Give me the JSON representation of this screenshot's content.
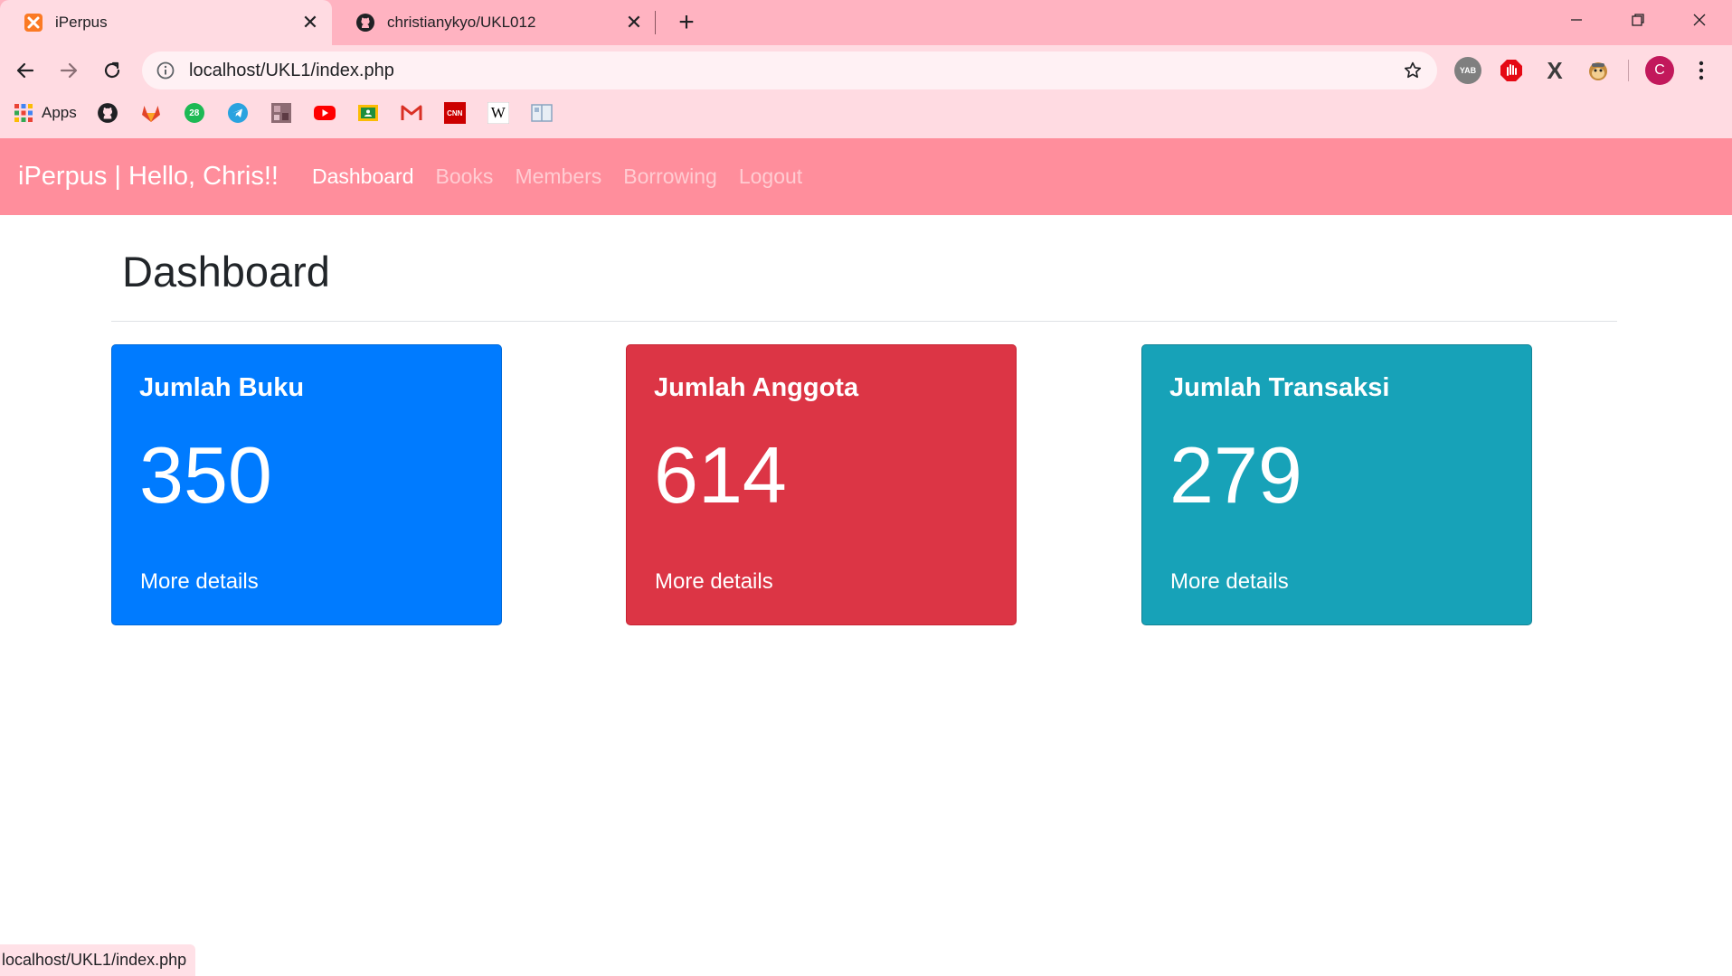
{
  "browser": {
    "tabs": [
      {
        "title": "iPerpus",
        "icon": "xampp-icon",
        "active": true
      },
      {
        "title": "christianykyo/UKL012",
        "icon": "github-icon",
        "active": false
      }
    ],
    "address": {
      "url": "localhost/UKL1/index.php"
    },
    "bookmarks": {
      "apps_label": "Apps",
      "items": [
        {
          "name": "github-icon"
        },
        {
          "name": "gitlab-icon"
        },
        {
          "name": "badge-28-icon",
          "text": "28"
        },
        {
          "name": "telegram-icon"
        },
        {
          "name": "photo-icon"
        },
        {
          "name": "youtube-icon"
        },
        {
          "name": "classroom-icon"
        },
        {
          "name": "gmail-icon"
        },
        {
          "name": "cnn-icon",
          "text": "CNN"
        },
        {
          "name": "wikipedia-icon",
          "text": "W"
        },
        {
          "name": "reader-icon"
        }
      ]
    },
    "extensions": [
      {
        "name": "yab-icon",
        "text": "YAB"
      },
      {
        "name": "stop-hand-icon"
      },
      {
        "name": "x-icon",
        "text": "X"
      },
      {
        "name": "monkey-icon"
      }
    ],
    "profile": {
      "initial": "C",
      "color": "#c2185b"
    },
    "status_url": "localhost/UKL1/index.php"
  },
  "site": {
    "brand": "iPerpus | Hello, Chris!!",
    "nav": [
      "Dashboard",
      "Books",
      "Members",
      "Borrowing",
      "Logout"
    ],
    "colors": {
      "navbar": "#ff8e9c",
      "chrome": "#ffdbe2",
      "tabstrip": "#ffb3c1"
    }
  },
  "page": {
    "title": "Dashboard",
    "cards": [
      {
        "title": "Jumlah Buku",
        "value": "350",
        "link": "More details",
        "color": "#007bff"
      },
      {
        "title": "Jumlah Anggota",
        "value": "614",
        "link": "More details",
        "color": "#dc3545"
      },
      {
        "title": "Jumlah Transaksi",
        "value": "279",
        "link": "More details",
        "color": "#17a2b8"
      }
    ]
  }
}
